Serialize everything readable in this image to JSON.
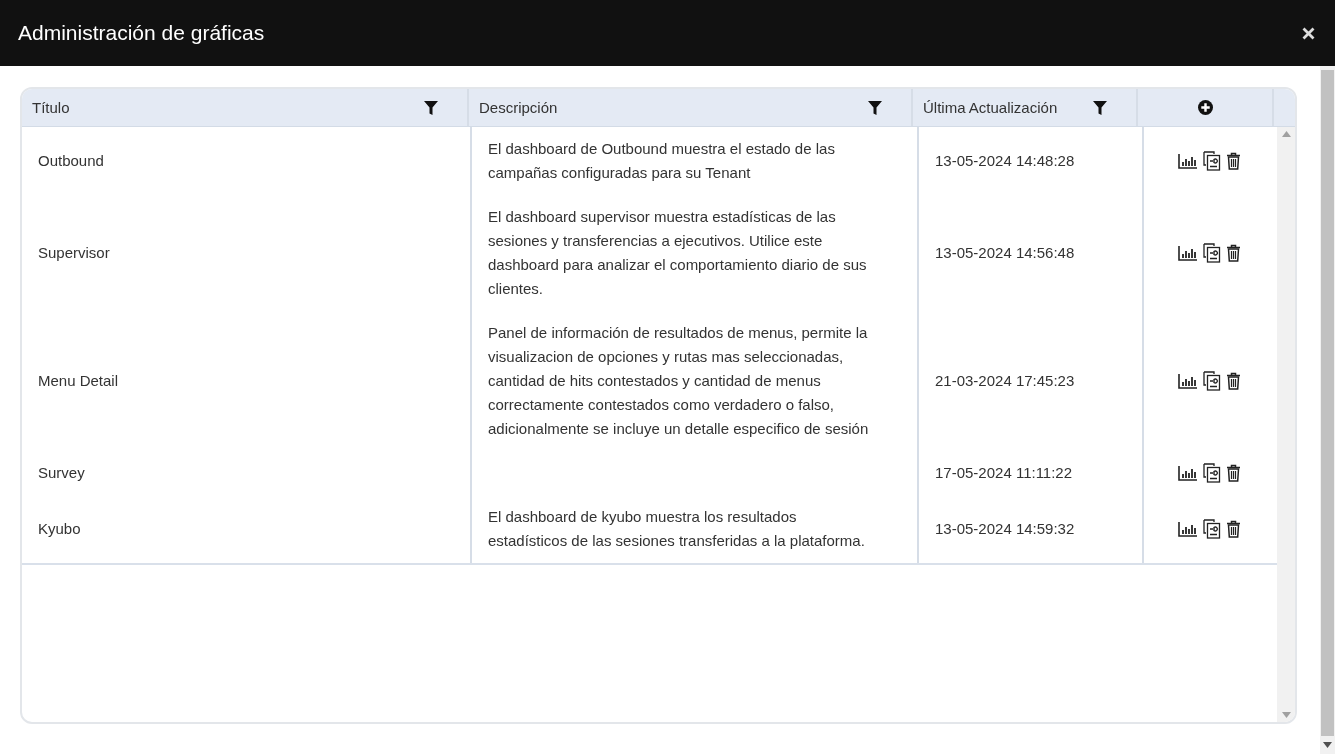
{
  "window": {
    "title": "Administración de gráficas"
  },
  "table": {
    "columns": [
      {
        "label": "Título",
        "filter": true
      },
      {
        "label": "Descripción",
        "filter": true
      },
      {
        "label": "Última Actualización",
        "filter": true
      }
    ],
    "rows": [
      {
        "title": "Outbound",
        "description": "El dashboard de Outbound muestra el estado de las campañas configuradas para su Tenant",
        "updated": "13-05-2024 14:48:28"
      },
      {
        "title": "Supervisor",
        "description": "El dashboard supervisor muestra estadísticas de las sesiones y transferencias a ejecutivos. Utilice este dashboard para analizar el comportamiento diario de sus clientes.",
        "updated": "13-05-2024 14:56:48"
      },
      {
        "title": "Menu Detail",
        "description": "Panel de información de resultados de menus, permite la visualizacion de opciones y rutas mas seleccionadas, cantidad de hits contestados y cantidad de menus correctamente contestados como verdadero o falso, adicionalmente se incluye un detalle especifico de sesión",
        "updated": "21-03-2024 17:45:23"
      },
      {
        "title": "Survey",
        "updated": "17-05-2024 11:11:22"
      },
      {
        "title": "Kyubo",
        "description": "El dashboard de kyubo muestra los resultados estadísticos de las sesiones transferidas a la plataforma.",
        "updated": "13-05-2024 14:59:32"
      }
    ]
  }
}
